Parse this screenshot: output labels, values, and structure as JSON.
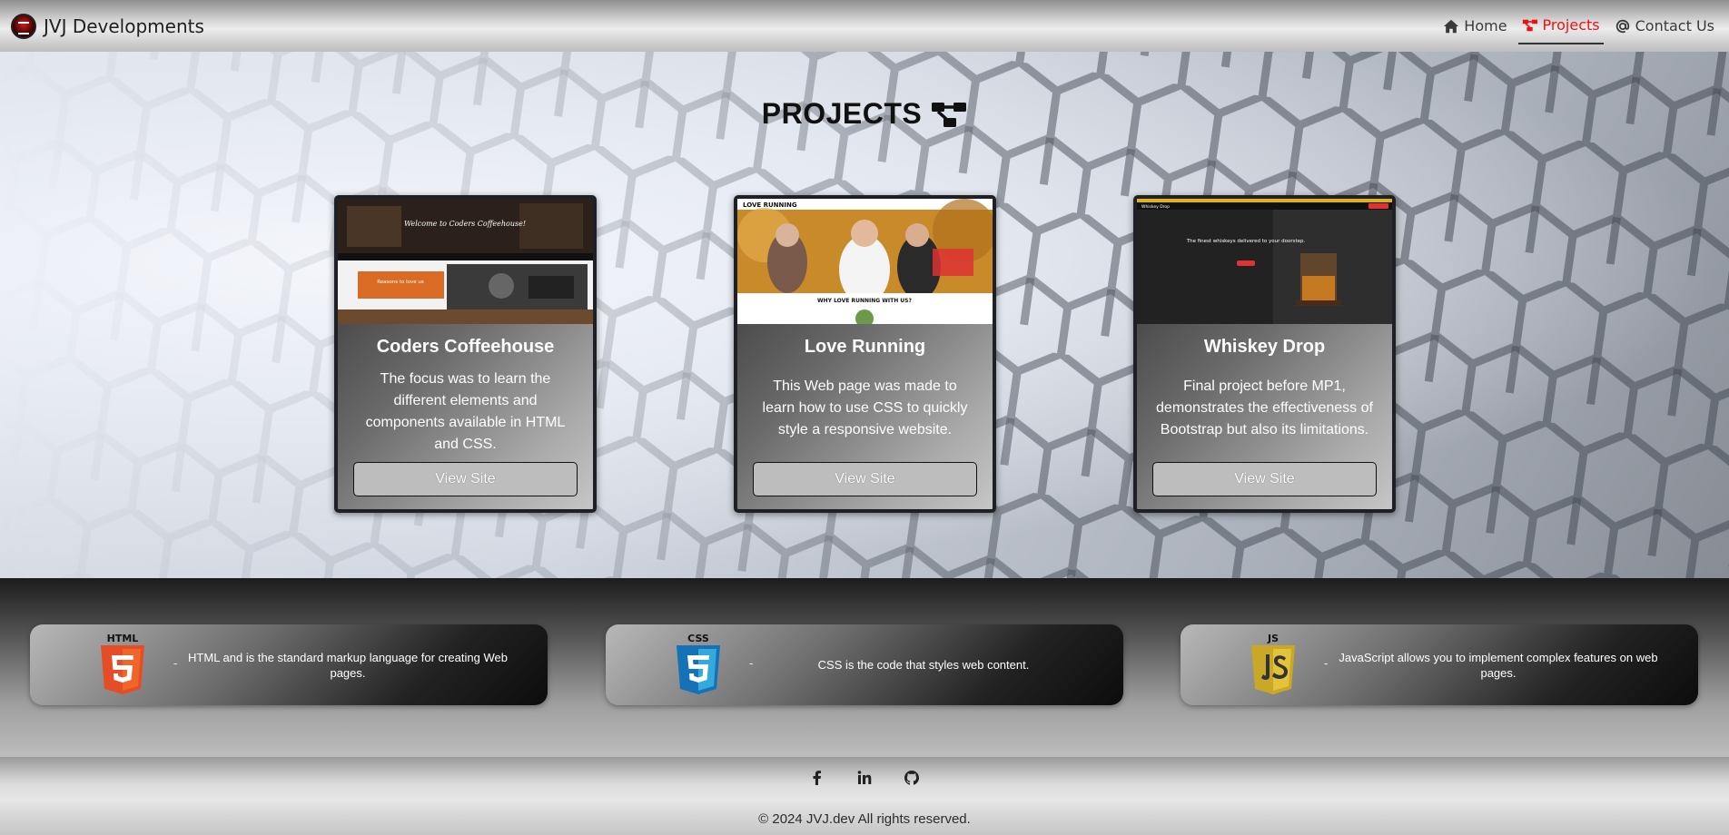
{
  "nav": {
    "brand": "JVJ Developments",
    "links": [
      {
        "label": "Home",
        "icon": "home-icon"
      },
      {
        "label": "Projects",
        "icon": "project-diagram-icon",
        "active": true
      },
      {
        "label": "Contact Us",
        "icon": "at-icon"
      }
    ]
  },
  "hero": {
    "title": "PROJECTS",
    "title_icon": "project-diagram-icon"
  },
  "projects": [
    {
      "title": "Coders Coffeehouse",
      "text": "The focus was to learn the different elements and components available in HTML and CSS.",
      "button": "View Site",
      "thumb_text": "Welcome to Coders Coffeehouse!",
      "thumb_subtext": "Reasons to love us"
    },
    {
      "title": "Love Running",
      "text": "This Web page was made to learn how to use CSS to quickly style a responsive website.",
      "button": "View Site",
      "thumb_text": "LOVE RUNNING",
      "thumb_subtext": "WHY LOVE RUNNING WITH US?"
    },
    {
      "title": "Whiskey Drop",
      "text": "Final project before MP1, demonstrates the effectiveness of Bootstrap but also its limitations.",
      "button": "View Site",
      "thumb_text": "The finest whiskeys delivered to your doorstep.",
      "thumb_subtext": "Whiskey Drop"
    }
  ],
  "tech": [
    {
      "name": "HTML",
      "icon": "html5-icon",
      "color": "#e44d26",
      "text": "HTML and is the standard markup language for creating Web pages."
    },
    {
      "name": "CSS",
      "icon": "css3-icon",
      "color": "#1572b6",
      "text": "CSS is the code that styles web content."
    },
    {
      "name": "JS",
      "icon": "js-icon",
      "color": "#d4b830",
      "text": "JavaScript allows you to implement complex features on web pages."
    }
  ],
  "tech_separator": "-",
  "footer": {
    "socials": [
      "facebook-icon",
      "linkedin-icon",
      "github-icon"
    ],
    "copyright": "© 2024 JVJ.dev All rights reserved."
  },
  "colors": {
    "active_nav": "#ee1111",
    "card_border": "#1e2026"
  }
}
